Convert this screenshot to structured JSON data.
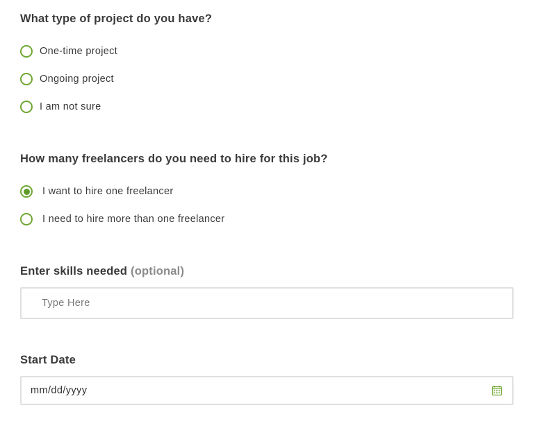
{
  "project_type": {
    "title": "What type of project do you have?",
    "options": [
      {
        "label": "One-time project",
        "selected": false
      },
      {
        "label": "Ongoing project",
        "selected": false
      },
      {
        "label": "I am not sure",
        "selected": false
      }
    ]
  },
  "freelancers": {
    "title": "How many freelancers do you need to hire for this job?",
    "options": [
      {
        "label": "I want to hire one freelancer",
        "selected": true
      },
      {
        "label": "I need to hire more than one freelancer",
        "selected": false
      }
    ]
  },
  "skills": {
    "title": "Enter skills needed",
    "optional_tag": "(optional)",
    "placeholder": "Type Here",
    "value": ""
  },
  "start_date": {
    "title": "Start Date",
    "value": "mm/dd/yyyy",
    "icon": "calendar-icon"
  },
  "colors": {
    "accent_green": "#6fa632",
    "text": "#3a3a3a",
    "muted": "#8a8a8a",
    "border": "#e0e0e0"
  }
}
